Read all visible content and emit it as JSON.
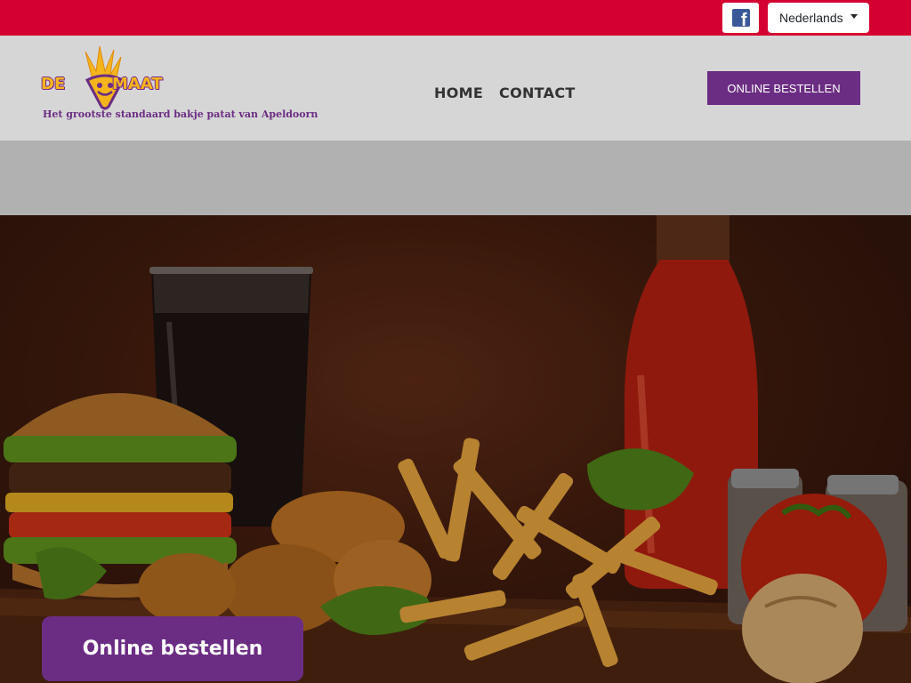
{
  "topbar": {
    "facebook_icon": "facebook-icon",
    "language": "Nederlands"
  },
  "header": {
    "logo_text_left": "DE",
    "logo_text_right": "MAAT",
    "logo_tagline": "Het grootste standaard bakje patat van Apeldoorn",
    "nav": [
      {
        "label": "HOME"
      },
      {
        "label": "CONTACT"
      }
    ],
    "order_button": "ONLINE BESTELLEN"
  },
  "hero": {
    "image": "fast-food-hero-image",
    "order_button": "Online bestellen"
  },
  "colors": {
    "topbar": "#d50032",
    "header_bg": "#d6d6d6",
    "band": "#b1b1b1",
    "brand_purple": "#6b2d83",
    "logo_yellow": "#f3b51b"
  }
}
